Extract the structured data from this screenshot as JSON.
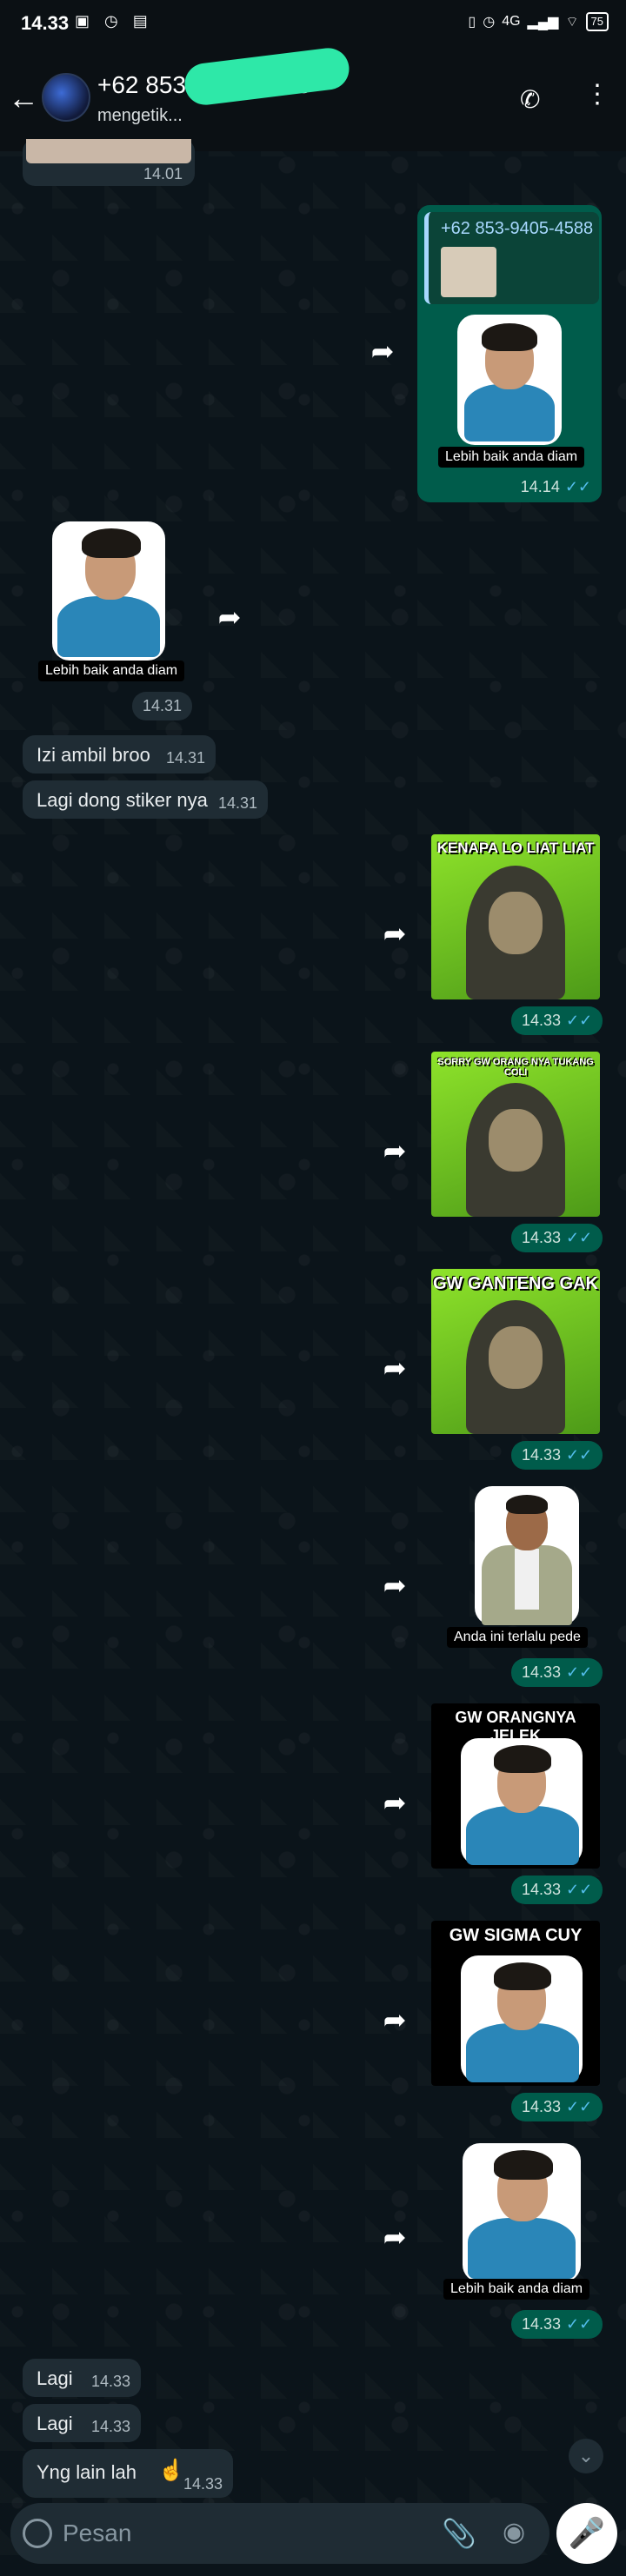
{
  "status_bar": {
    "time": "14.33",
    "battery": "75",
    "network": "4G"
  },
  "header": {
    "contact_name": "+62 853-9405-4588",
    "status": "mengetik..."
  },
  "messages": {
    "top_time": "14.01",
    "reply_quote": "+62 853-9405-4588",
    "sticker1_caption": "Lebih baik anda diam",
    "sticker1_time": "14.14",
    "sticker2_caption": "Lebih baik anda diam",
    "sticker2_time": "14.31",
    "text1": "Izi ambil broo",
    "text1_time": "14.31",
    "text2": "Lagi dong stiker nya",
    "text2_time": "14.31",
    "meme1_title": "KENAPA LO LIAT LIAT",
    "meme1_time": "14.33",
    "meme2_title": "SORRY GW ORANG NYA TUKANG COLI",
    "meme2_time": "14.33",
    "meme3_title": "GW GANTENG GAK",
    "meme3_time": "14.33",
    "sticker3_caption": "Anda ini terlalu pede",
    "sticker3_time": "14.33",
    "meme4_title": "GW ORANGNYA JELEK",
    "meme4_time": "14.33",
    "meme5_title": "GW SIGMA CUY",
    "meme5_time": "14.33",
    "sticker4_caption": "Lebih baik anda diam",
    "sticker4_time": "14.33",
    "text3": "Lagi",
    "text3_time": "14.33",
    "text4": "Lagi",
    "text4_time": "14.33",
    "text5": "Yng lain lah",
    "text5_time": "14.33"
  },
  "input": {
    "placeholder": "Pesan"
  },
  "icons": {
    "back": "arrow-left-icon",
    "forward": "forward-icon",
    "attach": "paperclip-icon",
    "camera": "camera-icon",
    "mic": "mic-icon",
    "emoji": "emoji-icon",
    "call": "add-call-icon"
  },
  "colors": {
    "bubble_out": "#005c4b",
    "bubble_in": "#1f2c34",
    "tick": "#53bdeb",
    "meme_green": "#6fc31f"
  }
}
